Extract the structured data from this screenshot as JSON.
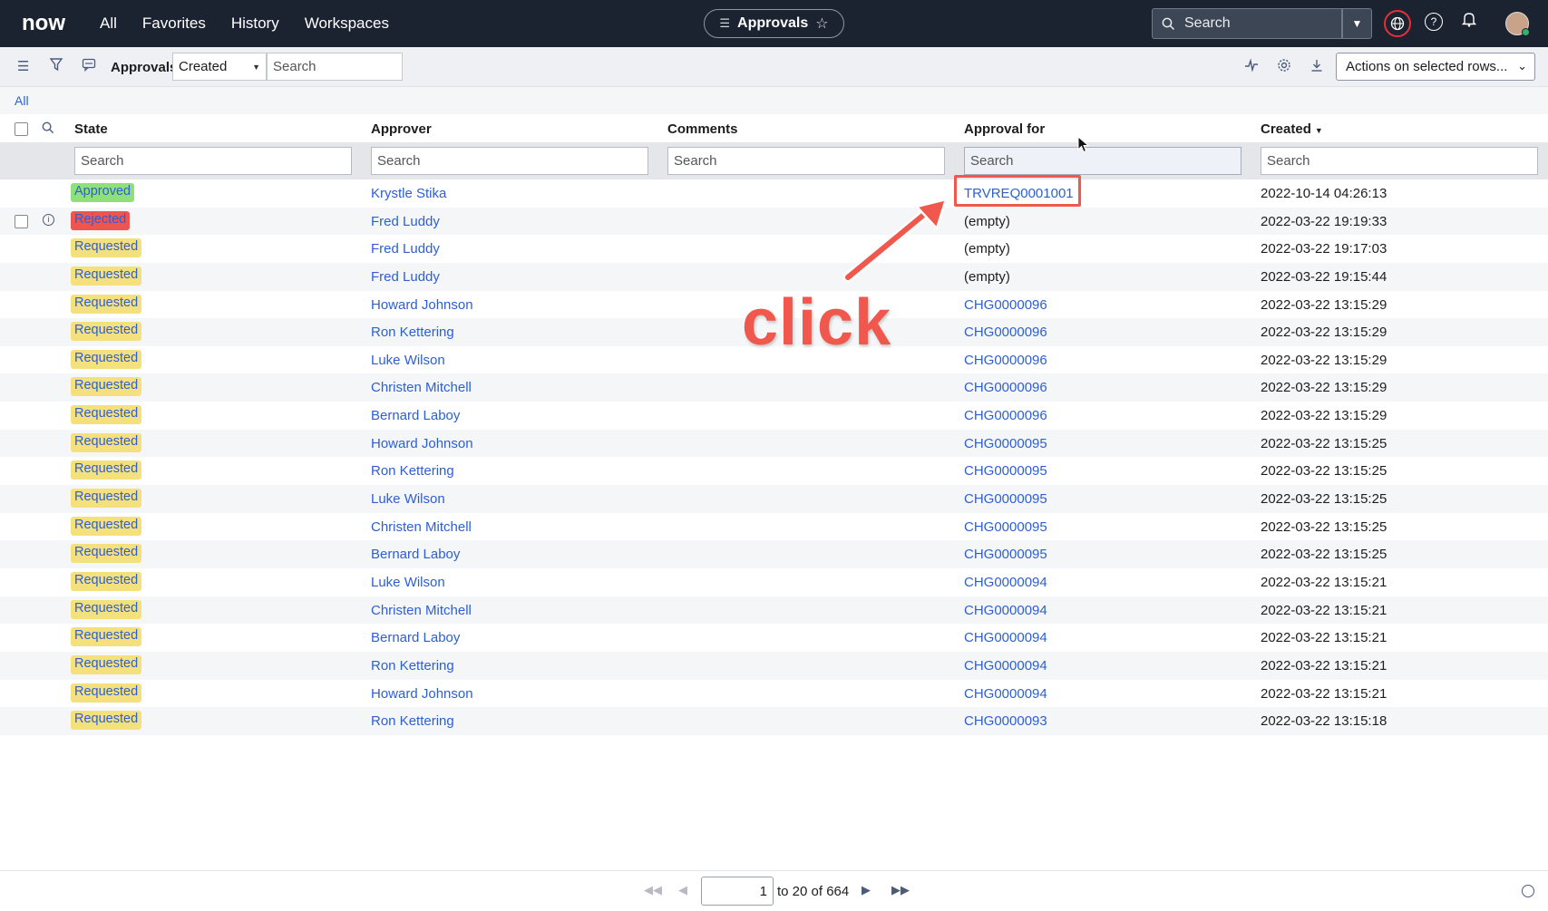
{
  "topnav": {
    "logo": "now",
    "items": [
      "All",
      "Favorites",
      "History",
      "Workspaces"
    ],
    "app_title": "Approvals",
    "search_placeholder": "Search"
  },
  "toolbar": {
    "title": "Approvals",
    "field_select": "Created",
    "search_placeholder": "Search",
    "actions_label": "Actions on selected rows..."
  },
  "breadcrumb": "All",
  "columns": [
    "State",
    "Approver",
    "Comments",
    "Approval for",
    "Created"
  ],
  "filter_placeholder": "Search",
  "rows": [
    {
      "state": "Approved",
      "approver": "Krystle Stika",
      "comments": "",
      "approval_for": "TRVREQ0001001",
      "created": "2022-10-14 04:26:13"
    },
    {
      "state": "Rejected",
      "approver": "Fred Luddy",
      "comments": "",
      "approval_for": "(empty)",
      "created": "2022-03-22 19:19:33"
    },
    {
      "state": "Requested",
      "approver": "Fred Luddy",
      "comments": "",
      "approval_for": "(empty)",
      "created": "2022-03-22 19:17:03"
    },
    {
      "state": "Requested",
      "approver": "Fred Luddy",
      "comments": "",
      "approval_for": "(empty)",
      "created": "2022-03-22 19:15:44"
    },
    {
      "state": "Requested",
      "approver": "Howard Johnson",
      "comments": "",
      "approval_for": "CHG0000096",
      "created": "2022-03-22 13:15:29"
    },
    {
      "state": "Requested",
      "approver": "Ron Kettering",
      "comments": "",
      "approval_for": "CHG0000096",
      "created": "2022-03-22 13:15:29"
    },
    {
      "state": "Requested",
      "approver": "Luke Wilson",
      "comments": "",
      "approval_for": "CHG0000096",
      "created": "2022-03-22 13:15:29"
    },
    {
      "state": "Requested",
      "approver": "Christen Mitchell",
      "comments": "",
      "approval_for": "CHG0000096",
      "created": "2022-03-22 13:15:29"
    },
    {
      "state": "Requested",
      "approver": "Bernard Laboy",
      "comments": "",
      "approval_for": "CHG0000096",
      "created": "2022-03-22 13:15:29"
    },
    {
      "state": "Requested",
      "approver": "Howard Johnson",
      "comments": "",
      "approval_for": "CHG0000095",
      "created": "2022-03-22 13:15:25"
    },
    {
      "state": "Requested",
      "approver": "Ron Kettering",
      "comments": "",
      "approval_for": "CHG0000095",
      "created": "2022-03-22 13:15:25"
    },
    {
      "state": "Requested",
      "approver": "Luke Wilson",
      "comments": "",
      "approval_for": "CHG0000095",
      "created": "2022-03-22 13:15:25"
    },
    {
      "state": "Requested",
      "approver": "Christen Mitchell",
      "comments": "",
      "approval_for": "CHG0000095",
      "created": "2022-03-22 13:15:25"
    },
    {
      "state": "Requested",
      "approver": "Bernard Laboy",
      "comments": "",
      "approval_for": "CHG0000095",
      "created": "2022-03-22 13:15:25"
    },
    {
      "state": "Requested",
      "approver": "Luke Wilson",
      "comments": "",
      "approval_for": "CHG0000094",
      "created": "2022-03-22 13:15:21"
    },
    {
      "state": "Requested",
      "approver": "Christen Mitchell",
      "comments": "",
      "approval_for": "CHG0000094",
      "created": "2022-03-22 13:15:21"
    },
    {
      "state": "Requested",
      "approver": "Bernard Laboy",
      "comments": "",
      "approval_for": "CHG0000094",
      "created": "2022-03-22 13:15:21"
    },
    {
      "state": "Requested",
      "approver": "Ron Kettering",
      "comments": "",
      "approval_for": "CHG0000094",
      "created": "2022-03-22 13:15:21"
    },
    {
      "state": "Requested",
      "approver": "Howard Johnson",
      "comments": "",
      "approval_for": "CHG0000094",
      "created": "2022-03-22 13:15:21"
    },
    {
      "state": "Requested",
      "approver": "Ron Kettering",
      "comments": "",
      "approval_for": "CHG0000093",
      "created": "2022-03-22 13:15:18"
    }
  ],
  "pagination": {
    "current": "1",
    "label": "to 20 of 664"
  },
  "annotation": {
    "text": "click"
  },
  "colors": {
    "nav_bg": "#1c2330",
    "link": "#2d5fd3",
    "approved": "#8ee07a",
    "rejected": "#f0544f",
    "requested": "#f5e07e",
    "annotation": "#f1584d"
  }
}
